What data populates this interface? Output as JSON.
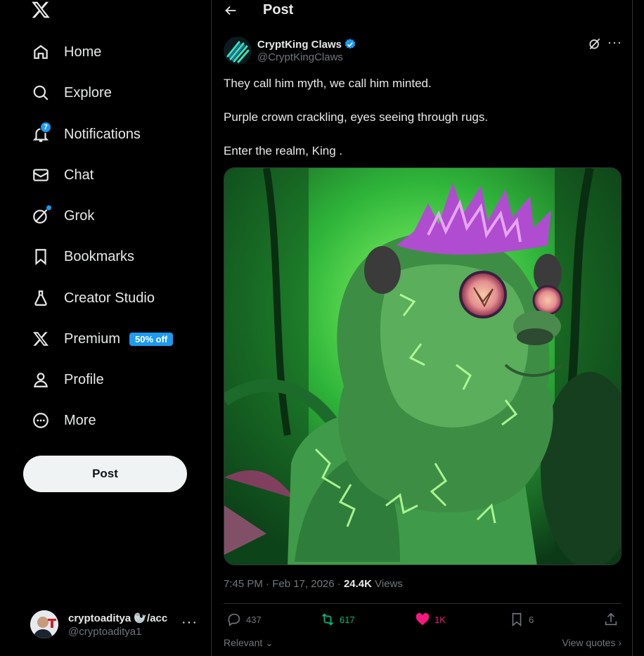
{
  "sidebar": {
    "logo": "x-logo-icon",
    "items": [
      {
        "label": "Home",
        "icon": "home-icon"
      },
      {
        "label": "Explore",
        "icon": "search-icon"
      },
      {
        "label": "Notifications",
        "icon": "bell-icon",
        "badge": "7"
      },
      {
        "label": "Chat",
        "icon": "mail-icon"
      },
      {
        "label": "Grok",
        "icon": "grok-icon"
      },
      {
        "label": "Bookmarks",
        "icon": "bookmark-icon"
      },
      {
        "label": "Creator Studio",
        "icon": "flask-icon"
      },
      {
        "label": "Premium",
        "icon": "x-icon",
        "promo": "50% off"
      },
      {
        "label": "Profile",
        "icon": "person-icon"
      },
      {
        "label": "More",
        "icon": "more-circle-icon"
      }
    ],
    "post_button": "Post",
    "account": {
      "name": "cryptoaditya 🦭/acc",
      "handle": "@cryptoaditya1",
      "more": "···"
    }
  },
  "header": {
    "title": "Post"
  },
  "tweet": {
    "author_name": "CryptKing Claws",
    "author_handle": "@CryptKingClaws",
    "more": "···",
    "lines": [
      "They call him myth, we call him minted.",
      "Purple crown crackling, eyes seeing through rugs.",
      "Enter the realm, King ."
    ],
    "time": "7:45 PM · Feb 17, 2026 · ",
    "views_count": "24.4K",
    "views_label": " Views",
    "stats": {
      "replies": "437",
      "reposts": "617",
      "likes": "1K",
      "bookmarks": "6"
    },
    "sort_label": "Relevant",
    "view_quotes": "View quotes"
  },
  "colors": {
    "accent": "#1d9bf0",
    "repost": "#00ba7c",
    "like": "#f91880",
    "muted": "#71767b"
  }
}
